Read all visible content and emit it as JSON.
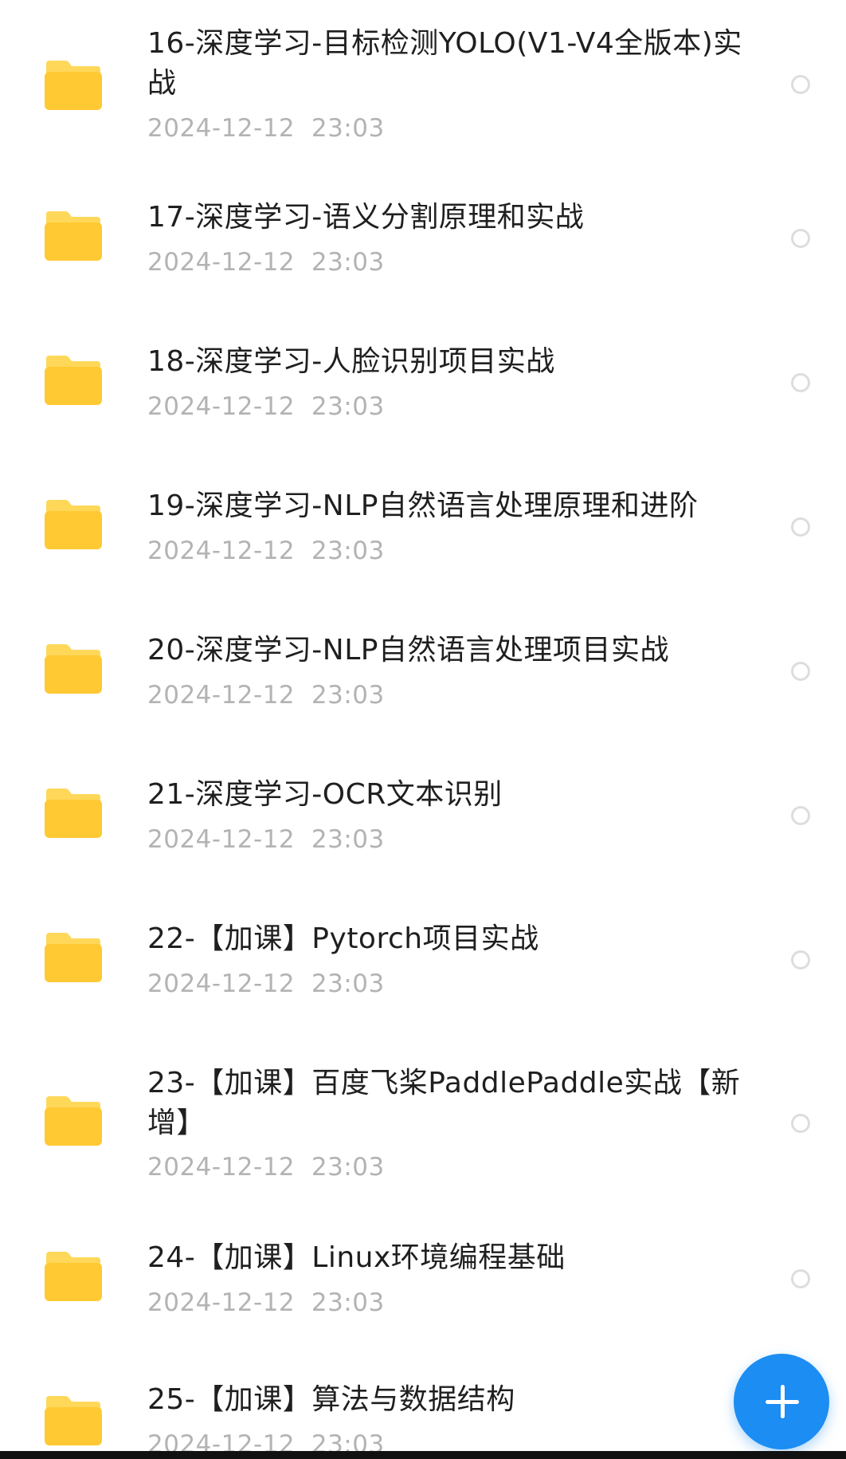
{
  "files": [
    {
      "name": "16-深度学习-目标检测YOLO(V1-V4全版本)实战",
      "date": "2024-12-12  23:03"
    },
    {
      "name": "17-深度学习-语义分割原理和实战",
      "date": "2024-12-12  23:03"
    },
    {
      "name": "18-深度学习-人脸识别项目实战",
      "date": "2024-12-12  23:03"
    },
    {
      "name": "19-深度学习-NLP自然语言处理原理和进阶",
      "date": "2024-12-12  23:03"
    },
    {
      "name": "20-深度学习-NLP自然语言处理项目实战",
      "date": "2024-12-12  23:03"
    },
    {
      "name": "21-深度学习-OCR文本识别",
      "date": "2024-12-12  23:03"
    },
    {
      "name": "22-【加课】Pytorch项目实战",
      "date": "2024-12-12  23:03"
    },
    {
      "name": "23-【加课】百度飞桨PaddlePaddle实战【新增】",
      "date": "2024-12-12  23:03"
    },
    {
      "name": "24-【加课】Linux环境编程基础",
      "date": "2024-12-12  23:03"
    },
    {
      "name": "25-【加课】算法与数据结构",
      "date": "2024-12-12  23:03"
    }
  ],
  "icons": {
    "folder": "folder-icon",
    "select": "radio-circle",
    "add": "plus-icon"
  },
  "colors": {
    "folder_top": "#FFD85A",
    "folder_body": "#FFC933",
    "accent": "#1C8DF2",
    "date_text": "#B3B3B3",
    "name_text": "#1F1F1F"
  }
}
